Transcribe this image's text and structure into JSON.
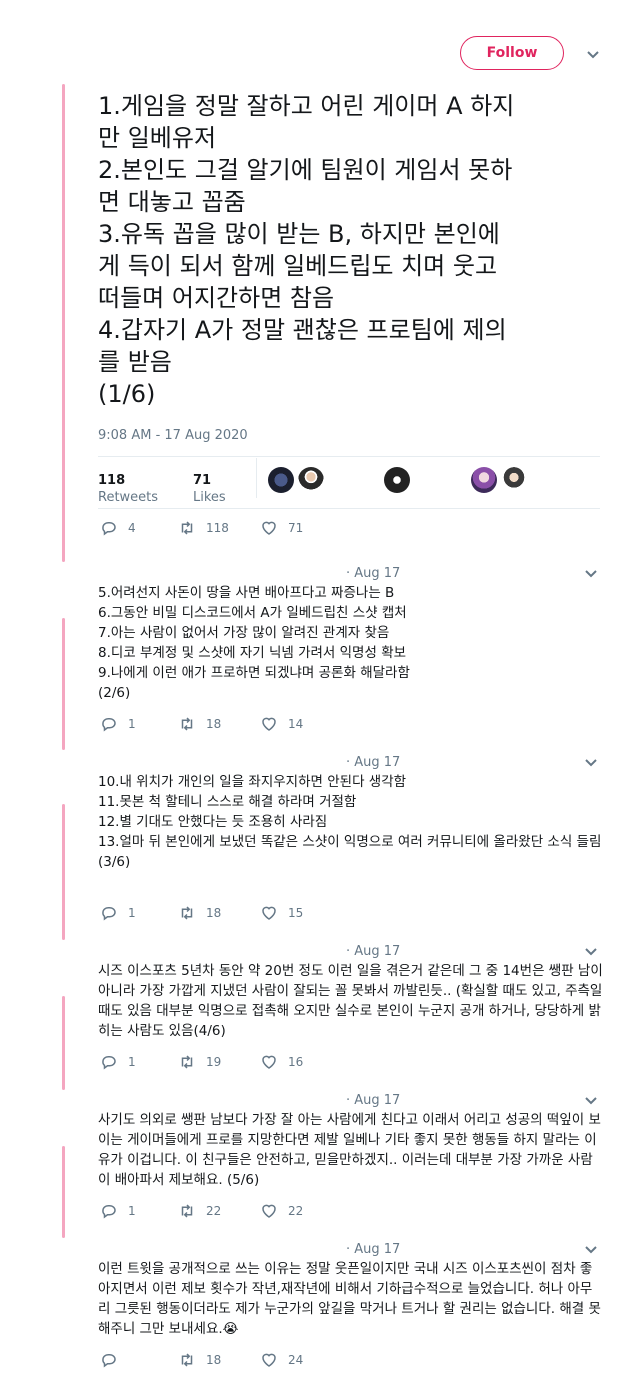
{
  "header": {
    "follow_label": "Follow"
  },
  "main_tweet": {
    "lines": [
      "1.게임을 정말 잘하고 어린 게이머 A 하지\n만 일베유저",
      "2.본인도 그걸 알기에 팀원이 게임서 못하\n면 대놓고 꼽줌",
      "3.유독 꼽을 많이 받는 B, 하지만 본인에\n게 득이 되서 함께 일베드립도 치며 웃고\n떠들며 어지간하면 참음",
      "4.갑자기 A가 정말 괜찮은 프로팀에 제의\n를 받음",
      "(1/6)"
    ],
    "timestamp": "9:08 AM - 17 Aug 2020",
    "retweets_count": "118",
    "retweets_label": "Retweets",
    "likes_count": "71",
    "likes_label": "Likes",
    "reply_count": "4",
    "retweet_count": "118",
    "like_count": "71"
  },
  "replies": [
    {
      "date": "· Aug 17",
      "lines": [
        "5.어려선지 사돈이 땅을 사면 배아프다고 짜증나는 B",
        "6.그동안 비밀 디스코드에서 A가 일베드립친 스샷 캡처",
        "7.아는 사람이 없어서 가장 많이 알려진 관계자 찾음",
        "8.디코 부계정 및 스샷에 자기 닉넴 가려서 익명성 확보",
        "9.나에게 이런 애가 프로하면 되겠냐며 공론화 해달라함",
        "(2/6)"
      ],
      "reply": "1",
      "retweet": "18",
      "like": "14"
    },
    {
      "date": "· Aug 17",
      "lines": [
        "10.내 위치가 개인의 일을 좌지우지하면 안된다 생각함",
        "11.못본 척 할테니 스스로 해결 하라며 거절함",
        "12.별 기대도 안했다는 듯 조용히 사라짐",
        "13.얼마 뒤 본인에게 보냈던 똑같은 스샷이 익명으로 여러 커뮤니티에 올라왔단 소식 들림",
        "(3/6)"
      ],
      "reply": "1",
      "retweet": "18",
      "like": "15"
    },
    {
      "date": "· Aug 17",
      "lines": [
        "시즈 이스포츠 5년차 동안 약 20번 정도 이런 일을 겪은거 같은데 그 중 14번은 쌩판 남이 아니라 가장 가깝게 지냈던 사람이 잘되는 꼴 못봐서 까발린듯.. (확실할 때도 있고, 주측일 때도 있음 대부분 익명으로 접촉해 오지만 실수로 본인이 누군지 공개 하거나, 당당하게 밝히는 사람도 있음(4/6)"
      ],
      "reply": "1",
      "retweet": "19",
      "like": "16"
    },
    {
      "date": "· Aug 17",
      "lines": [
        "사기도 의외로 쌩판 남보다 가장 잘 아는 사람에게 친다고 이래서 어리고 성공의 떡잎이 보이는 게이머들에게 프로를 지망한다면 제발 일베나 기타 좋지 못한 행동들 하지 말라는 이유가 이겁니다. 이 친구들은 안전하고, 믿을만하겠지.. 이러는데 대부분 가장 가까운 사람이 배아파서 제보해요. (5/6)"
      ],
      "reply": "1",
      "retweet": "22",
      "like": "22"
    },
    {
      "date": "· Aug 17",
      "lines": [
        "이런 트윗을 공개적으로 쓰는 이유는 정말 웃픈일이지만 국내 시즈 이스포츠씬이 점차 좋아지면서 이런 제보 횟수가 작년,재작년에 비해서 기하급수적으로 늘었습니다. 허나 아무리 그릇된 행동이더라도 제가 누군가의 앞길을 막거나 트거나 할 권리는 없습니다. 해결 못해주니 그만 보내세요.😭"
      ],
      "reply": "",
      "retweet": "18",
      "like": "24"
    }
  ],
  "colors": {
    "accent": "#e0245e",
    "thread_line": "#f4a6c0",
    "muted": "#657786"
  },
  "icons": [
    "chevron-down-icon",
    "reply-icon",
    "retweet-icon",
    "heart-icon"
  ]
}
